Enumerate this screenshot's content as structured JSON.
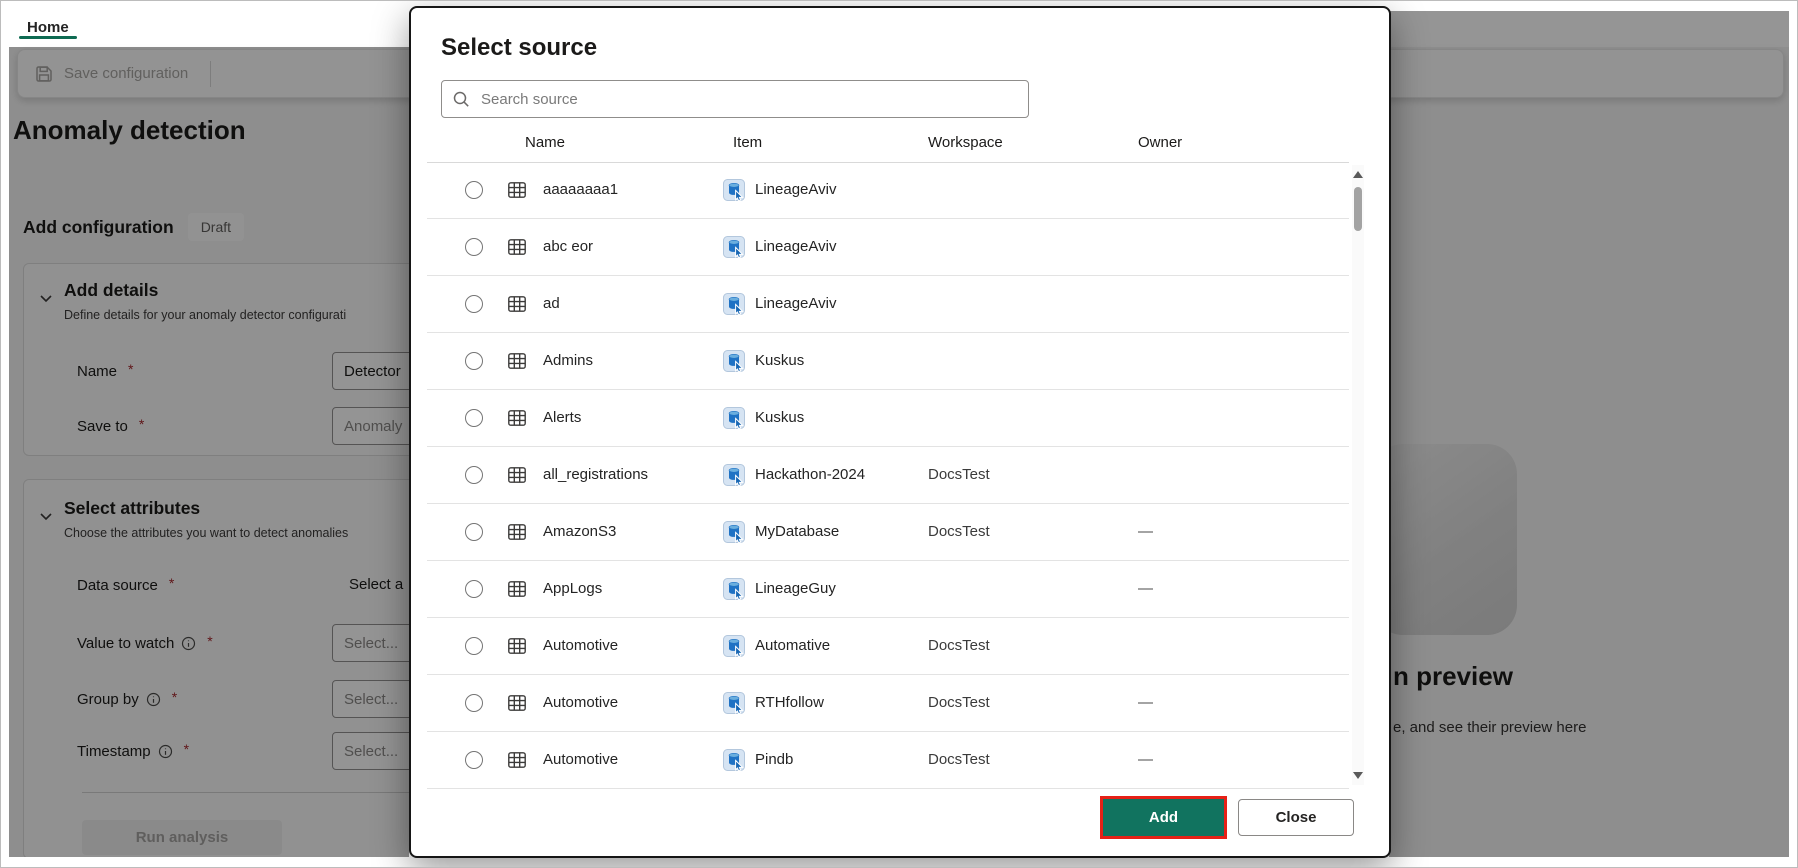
{
  "page": {
    "tab": "Home",
    "toolbar": {
      "save_label": "Save configuration"
    },
    "title": "Anomaly detection",
    "config_section": {
      "title": "Add configuration",
      "badge": "Draft"
    },
    "add_details": {
      "title": "Add details",
      "subtitle": "Define details for your anomaly detector configurati",
      "name_label": "Name",
      "name_value": "Detector",
      "save_to_label": "Save to",
      "save_to_placeholder": "Anomaly"
    },
    "select_attributes": {
      "title": "Select attributes",
      "subtitle": "Choose the attributes you want to detect anomalies",
      "data_source_label": "Data source",
      "data_source_value": "Select a",
      "value_to_watch_label": "Value to watch",
      "group_by_label": "Group by",
      "timestamp_label": "Timestamp",
      "select_placeholder": "Select...",
      "run_button": "Run analysis"
    },
    "preview_panel": {
      "heading_fragment": "n preview",
      "subtitle_fragment": "e, and see their preview here"
    },
    "required_mark": "*"
  },
  "modal": {
    "title": "Select source",
    "search_placeholder": "Search source",
    "columns": {
      "name": "Name",
      "item": "Item",
      "workspace": "Workspace",
      "owner": "Owner"
    },
    "rows": [
      {
        "name": "aaaaaaaa1",
        "item": "LineageAviv",
        "workspace": "",
        "owner": ""
      },
      {
        "name": "abc eor",
        "item": "LineageAviv",
        "workspace": "",
        "owner": ""
      },
      {
        "name": "ad",
        "item": "LineageAviv",
        "workspace": "",
        "owner": ""
      },
      {
        "name": "Admins",
        "item": "Kuskus",
        "workspace": "",
        "owner": ""
      },
      {
        "name": "Alerts",
        "item": "Kuskus",
        "workspace": "",
        "owner": ""
      },
      {
        "name": "all_registrations",
        "item": "Hackathon-2024",
        "workspace": "DocsTest",
        "owner": ""
      },
      {
        "name": "AmazonS3",
        "item": "MyDatabase",
        "workspace": "DocsTest",
        "owner": "—"
      },
      {
        "name": "AppLogs",
        "item": "LineageGuy",
        "workspace": "",
        "owner": "—"
      },
      {
        "name": "Automotive",
        "item": "Automative",
        "workspace": "DocsTest",
        "owner": ""
      },
      {
        "name": "Automotive",
        "item": "RTHfollow",
        "workspace": "DocsTest",
        "owner": "—"
      },
      {
        "name": "Automotive",
        "item": "Pindb",
        "workspace": "DocsTest",
        "owner": "—"
      }
    ],
    "add_button": "Add",
    "close_button": "Close"
  },
  "icons": {
    "save": "floppy-disk",
    "search": "magnifier",
    "section_chevron": "chevron-down",
    "info": "info-circle",
    "table": "table-grid",
    "item_type": "kql-database",
    "scroll_up": "triangle-up",
    "scroll_down": "triangle-down"
  },
  "colors": {
    "accent_green": "#11735f",
    "tab_underline": "#0e6b52",
    "annotation_red": "#e62117",
    "required_red": "#a4262c",
    "item_icon_blue": "#1f72c4",
    "dim_overlay": "rgba(0,0,0,0.415)"
  }
}
